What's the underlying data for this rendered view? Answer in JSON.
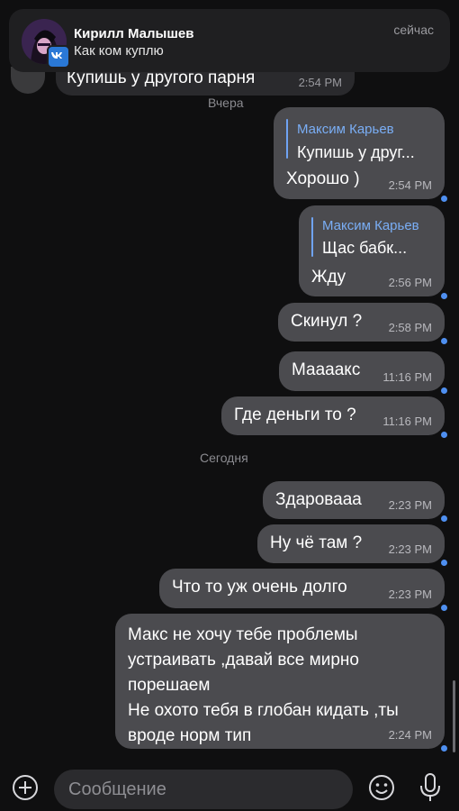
{
  "notification": {
    "sender": "Кирилл Малышев",
    "text": "Как ком куплю",
    "time": "сейчас"
  },
  "partial_message": {
    "text": "Купишь у другого парня",
    "time": "2:54 PM"
  },
  "date_separators": {
    "yesterday": "Вчера",
    "today": "Сегодня"
  },
  "messages": [
    {
      "reply_name": "Максим Карьев",
      "reply_text": "Купишь у друг...",
      "text": "Хорошо )",
      "time": "2:54 PM"
    },
    {
      "reply_name": "Максим Карьев",
      "reply_text": "Щас бабк...",
      "text": "Жду",
      "time": "2:56 PM"
    },
    {
      "text": "Скинул ?",
      "time": "2:58 PM"
    },
    {
      "text": "Маааакс",
      "time": "11:16 PM"
    },
    {
      "text": "Где деньги то ?",
      "time": "11:16 PM"
    },
    {
      "text": "Здаровааа",
      "time": "2:23 PM"
    },
    {
      "text": "Ну чё там ?",
      "time": "2:23 PM"
    },
    {
      "text": "Что то уж очень долго",
      "time": "2:23 PM"
    },
    {
      "text": "Макс не хочу тебе проблемы\nустраивать ,давай все мирно\nпорешаем\nНе охото тебя в глобан кидать ,ты\nвроде норм тип",
      "time": "2:24 PM"
    }
  ],
  "input": {
    "placeholder": "Сообщение"
  },
  "icons": {
    "attach": "plus-circle-icon",
    "emoji": "smile-icon",
    "voice": "microphone-icon",
    "app": "vk-logo-icon"
  },
  "colors": {
    "background": "#0f0f10",
    "bubble": "#4b4b4f",
    "accent": "#6fa3f3",
    "unread_dot": "#4e8ff0"
  }
}
